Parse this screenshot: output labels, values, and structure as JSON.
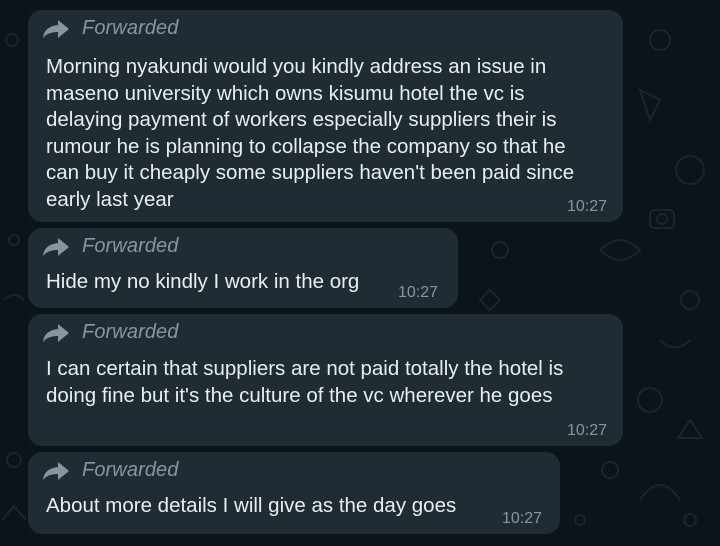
{
  "chat": {
    "messages": [
      {
        "forwarded_label": "Forwarded",
        "forward_icon": "forward-arrow-icon",
        "text": "Morning nyakundi would you kindly address an issue in\nmaseno university which owns kisumu hotel the vc is\ndelaying payment of workers especially suppliers their is\nrumour he is planning to collapse the company so that he\ncan buy it cheaply some suppliers haven't been paid since\nearly last year",
        "time": "10:27"
      },
      {
        "forwarded_label": "Forwarded",
        "forward_icon": "forward-arrow-icon",
        "text": "Hide my no kindly I work in the org",
        "time": "10:27"
      },
      {
        "forwarded_label": "Forwarded",
        "forward_icon": "forward-arrow-icon",
        "text": "I can certain that suppliers are not paid totally the hotel is\ndoing fine but it's the culture of the vc wherever he goes",
        "time": "10:27"
      },
      {
        "forwarded_label": "Forwarded",
        "forward_icon": "forward-arrow-icon",
        "text": "About more details I will give as the day goes",
        "time": "10:27"
      }
    ]
  },
  "colors": {
    "background": "#0b141a",
    "bubble": "#202c33",
    "text": "#e9edef",
    "meta": "#8696a0"
  }
}
